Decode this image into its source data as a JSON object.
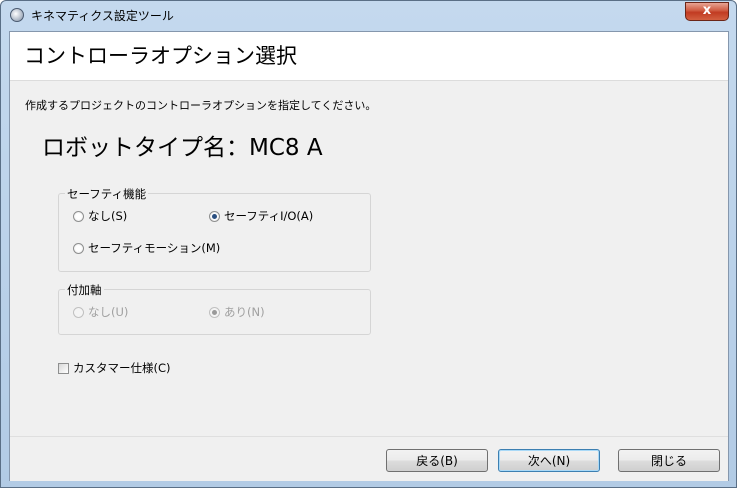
{
  "window": {
    "title": "キネマティクス設定ツール",
    "close_glyph": "x"
  },
  "header": {
    "title": "コントローラオプション選択"
  },
  "description": "作成するプロジェクトのコントローラオプションを指定してください。",
  "robot_type": "ロボットタイプ名：MC8 A",
  "safety_group": {
    "label": "セーフティ機能",
    "options": [
      {
        "label": "なし(S)",
        "checked": false
      },
      {
        "label": "セーフティI/O(A)",
        "checked": true
      },
      {
        "label": "セーフティモーション(M)",
        "checked": false
      }
    ]
  },
  "axis_group": {
    "label": "付加軸",
    "options": [
      {
        "label": "なし(U)",
        "checked": false,
        "enabled": false
      },
      {
        "label": "あり(N)",
        "checked": true,
        "enabled": false
      }
    ]
  },
  "custom_spec": {
    "label": "カスタマー仕様(C)",
    "checked": false
  },
  "buttons": {
    "back": "戻る(B)",
    "next": "次へ(N)",
    "close": "閉じる"
  }
}
